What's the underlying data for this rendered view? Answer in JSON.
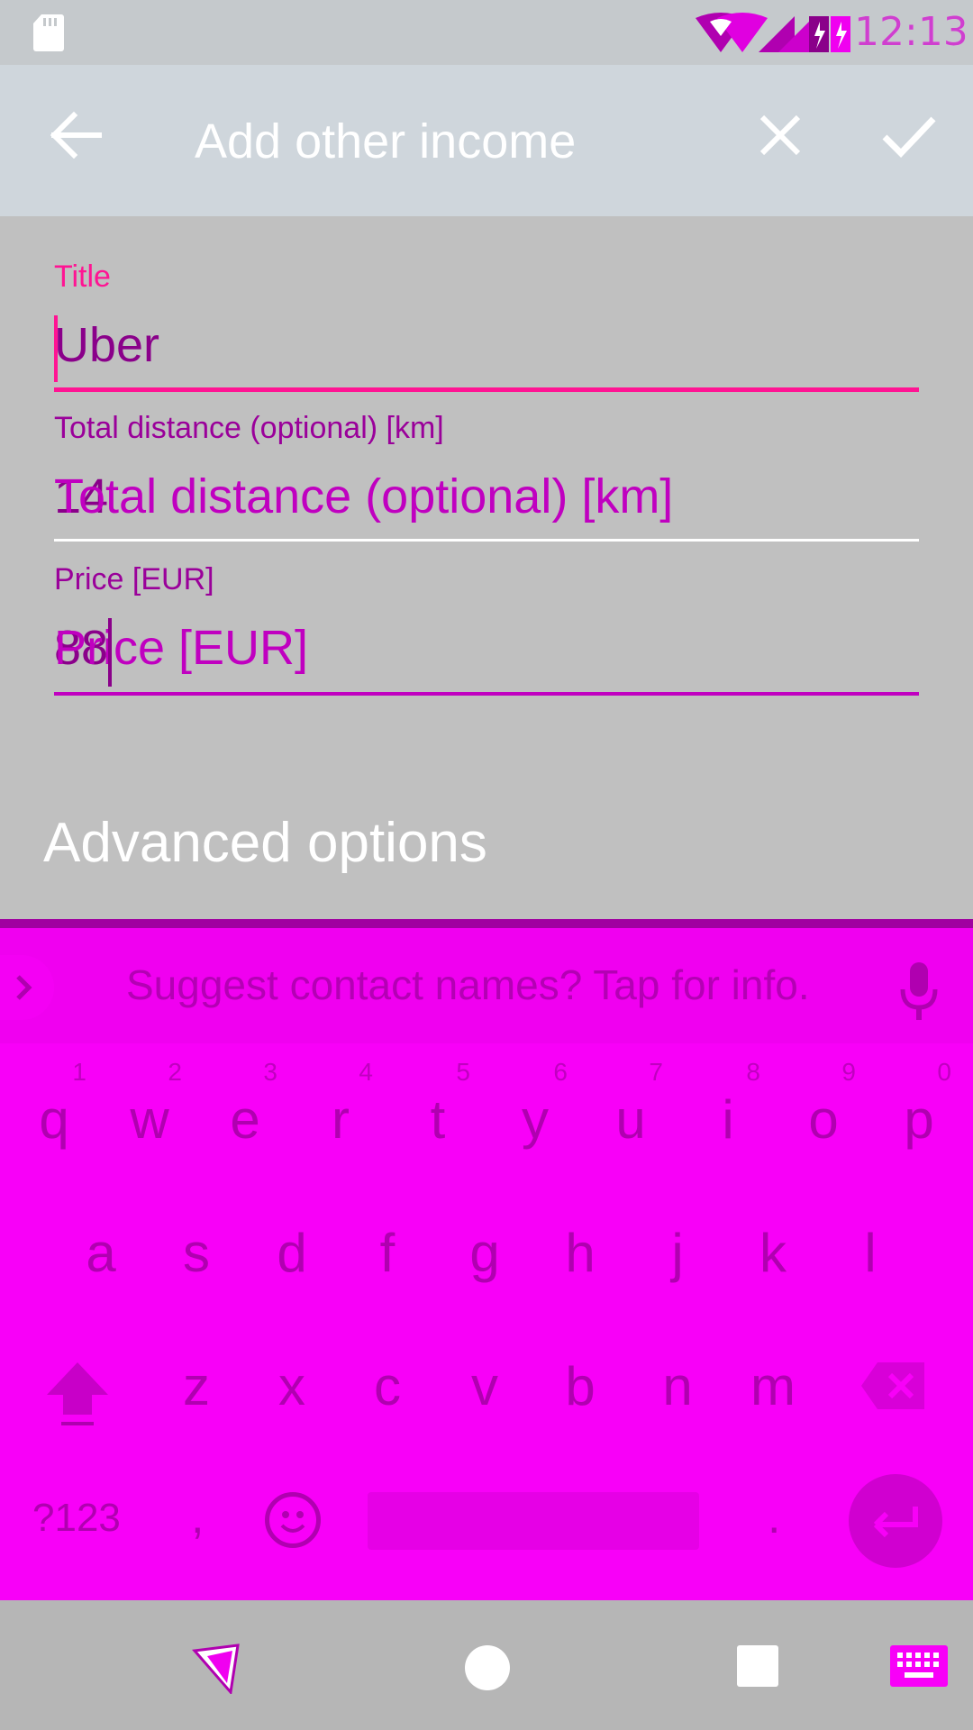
{
  "status_bar": {
    "time": "12:13",
    "time_overlay": "12:13"
  },
  "app_bar": {
    "title": "Add other income"
  },
  "form": {
    "title": {
      "label": "Title",
      "value": "Uber"
    },
    "distance": {
      "label": "Total distance (optional) [km]",
      "value": "14",
      "placeholder": "Total distance (optional) [km]"
    },
    "price": {
      "label": "Price [EUR]",
      "value": "88",
      "placeholder": "Price [EUR]"
    },
    "advanced_label": "Advanced options"
  },
  "keyboard": {
    "suggestion": "Suggest contact names? Tap for info.",
    "row1": [
      {
        "k": "q",
        "h": "1"
      },
      {
        "k": "w",
        "h": "2"
      },
      {
        "k": "e",
        "h": "3"
      },
      {
        "k": "r",
        "h": "4"
      },
      {
        "k": "t",
        "h": "5"
      },
      {
        "k": "y",
        "h": "6"
      },
      {
        "k": "u",
        "h": "7"
      },
      {
        "k": "i",
        "h": "8"
      },
      {
        "k": "o",
        "h": "9"
      },
      {
        "k": "p",
        "h": "0"
      }
    ],
    "row2": [
      "a",
      "s",
      "d",
      "f",
      "g",
      "h",
      "j",
      "k",
      "l"
    ],
    "row3": [
      "z",
      "x",
      "c",
      "v",
      "b",
      "n",
      "m"
    ],
    "symbols_label": "?123",
    "comma_label": ",",
    "period_label": "."
  },
  "colors": {
    "accent": "#ff1493",
    "keyboard_bg": "#f800f8",
    "app_bar": "#cfd6dc"
  }
}
